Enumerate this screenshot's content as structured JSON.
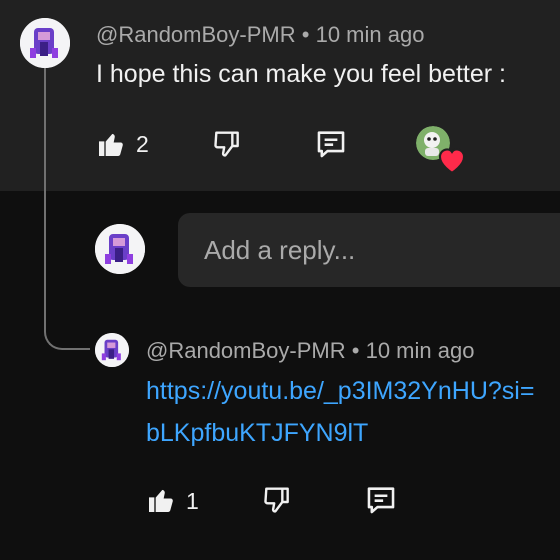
{
  "comment": {
    "author": "@RandomBoy-PMR",
    "separator": "•",
    "time": "10 min ago",
    "text": "I hope this can make you feel better :",
    "likes": "2"
  },
  "reply_box": {
    "placeholder": "Add a reply..."
  },
  "reply": {
    "author": "@RandomBoy-PMR",
    "separator": "•",
    "time": "10 min ago",
    "link_line1": "https://youtu.be/_p3IM32YnHU?si=",
    "link_line2": "bLKpfbuKTJFYN9lT",
    "likes": "1"
  },
  "colors": {
    "link": "#3ea6ff",
    "heart": "#ff2a4a",
    "panel": "#212121",
    "background": "#0f0f0f"
  }
}
